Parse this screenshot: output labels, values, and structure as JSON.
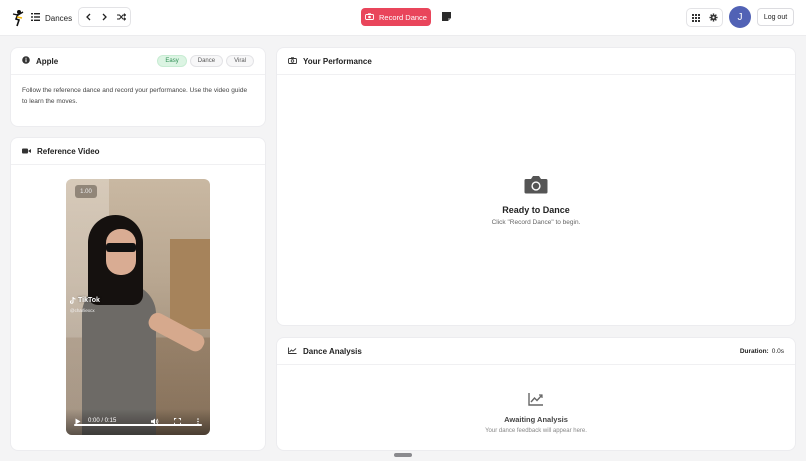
{
  "header": {
    "nav_label": "Dances",
    "record_label": "Record Dance",
    "avatar_initial": "J",
    "logout_label": "Log out"
  },
  "info_card": {
    "title": "Apple",
    "tags": [
      "Easy",
      "Dance",
      "Viral"
    ],
    "description": "Follow the reference dance and record your performance. Use the video guide to learn the moves."
  },
  "reference_card": {
    "title": "Reference Video",
    "video": {
      "speed": "1.00",
      "watermark": "TikTok",
      "handle": "@charliexcx",
      "time": "0:00 / 0:15",
      "progress": 1.0
    }
  },
  "performance_card": {
    "title": "Your Performance",
    "empty_title": "Ready to Dance",
    "empty_subtitle": "Click \"Record Dance\" to begin."
  },
  "analysis_card": {
    "title": "Dance Analysis",
    "duration_label": "Duration:",
    "duration_value": "0.0s",
    "empty_title": "Awaiting Analysis",
    "empty_subtitle": "Your dance feedback will appear here."
  },
  "colors": {
    "accent": "#e9455b",
    "avatar": "#5162b5",
    "easy_tag": "#dcf4e3"
  }
}
